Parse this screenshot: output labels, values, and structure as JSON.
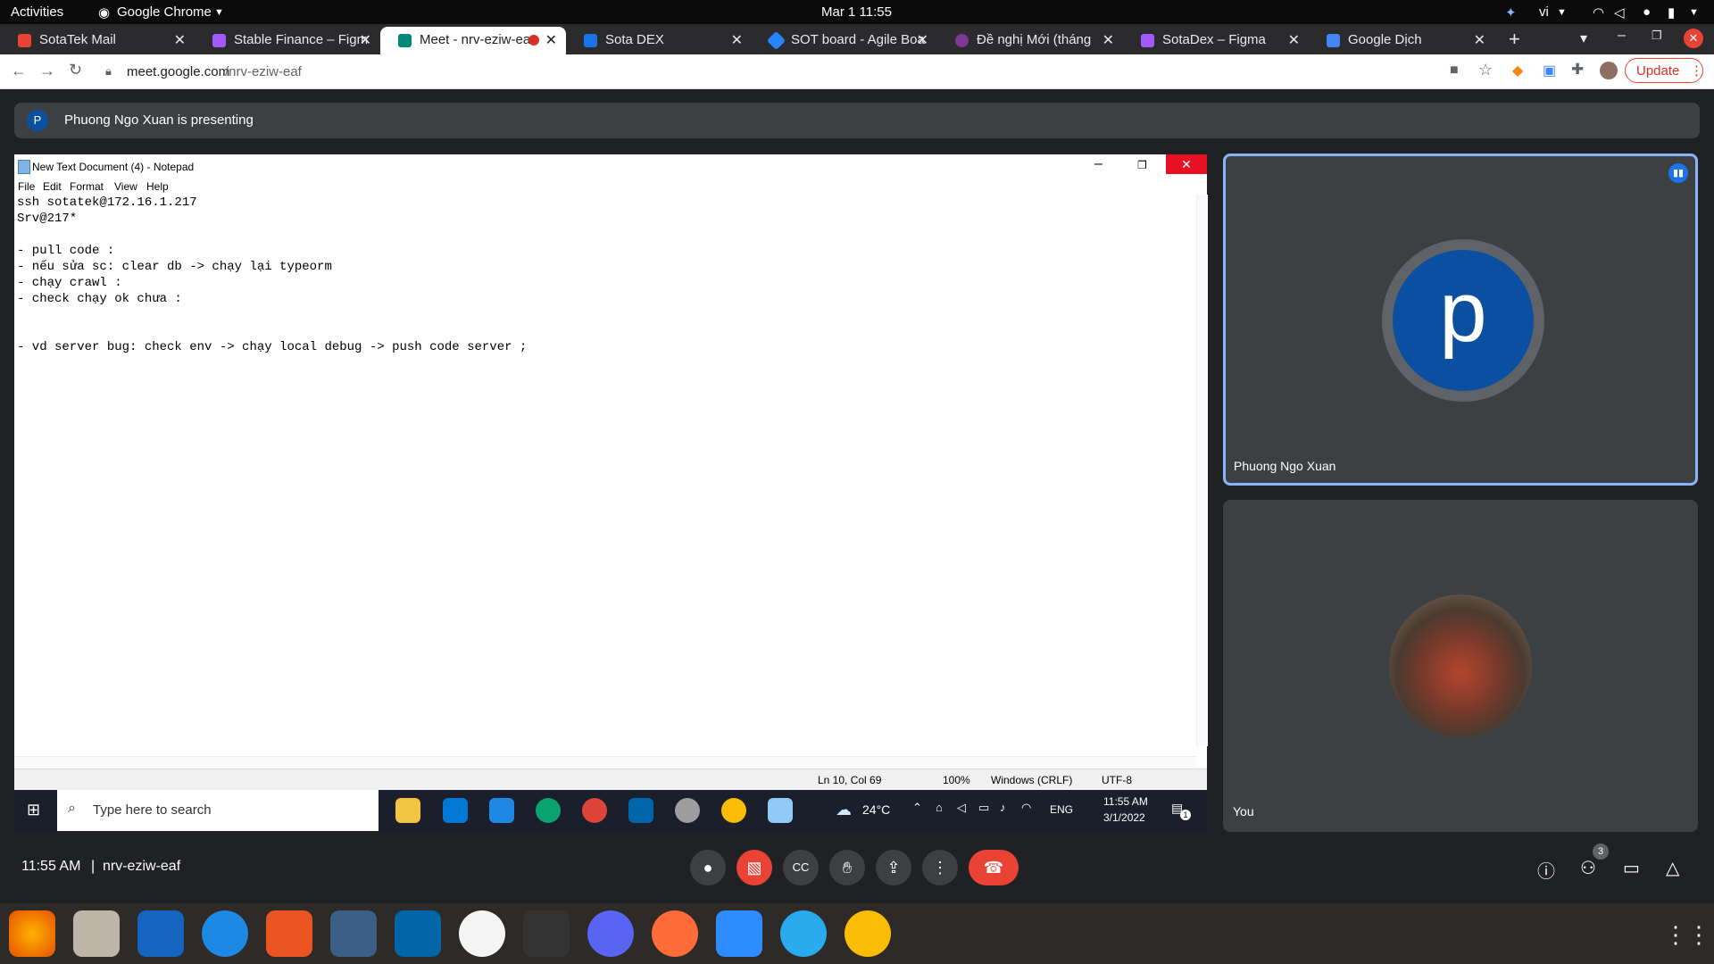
{
  "gnome": {
    "activities": "Activities",
    "app_name": "Google Chrome",
    "clock": "Mar 1  11:55",
    "lang": "vi"
  },
  "tabs": [
    {
      "label": "SotaTek Mail",
      "color": "#ea4335",
      "active": false
    },
    {
      "label": "Stable Finance – Figma",
      "color": "#a259ff",
      "active": false
    },
    {
      "label": "Meet - nrv-eziw-eaf",
      "color": "#00897b",
      "active": true
    },
    {
      "label": "Sota DEX",
      "color": "#1a73e8",
      "active": false
    },
    {
      "label": "SOT board - Agile Board",
      "color": "#2684ff",
      "active": false
    },
    {
      "label": "Đề nghị Mới (tháng",
      "color": "#7e3794",
      "active": false
    },
    {
      "label": "SotaDex – Figma",
      "color": "#a259ff",
      "active": false
    },
    {
      "label": "Google Dịch",
      "color": "#4285f4",
      "active": false
    }
  ],
  "toolbar": {
    "url_host": "meet.google.com",
    "url_path": "/nrv-eziw-eaf",
    "update_label": "Update"
  },
  "banner": {
    "avatar_letter": "P",
    "text": "Phuong Ngo Xuan is presenting"
  },
  "notepad": {
    "title": "New Text Document (4) - Notepad",
    "menu": [
      "File",
      "Edit",
      "Format",
      "View",
      "Help"
    ],
    "lines": [
      "ssh sotatek@172.16.1.217",
      "Srv@217*",
      "",
      "- pull code :",
      "- nếu sửa sc: clear db -> chạy lại typeorm",
      "- chạy crawl :",
      "- check chạy ok chưa :",
      "",
      "",
      "- vd server bug: check env -> chạy local debug -> push code server ;"
    ],
    "status": {
      "position": "Ln 10, Col 69",
      "zoom": "100%",
      "line_ending": "Windows (CRLF)",
      "encoding": "UTF-8"
    }
  },
  "win_taskbar": {
    "search_placeholder": "Type here to search",
    "weather": "24°C",
    "lang": "ENG",
    "time": "11:55 AM",
    "date": "3/1/2022",
    "notif_count": "1"
  },
  "tiles": {
    "presenter_name": "Phuong Ngo Xuan",
    "presenter_letter": "p",
    "self_name": "You"
  },
  "meet_bar": {
    "time": "11:55 AM",
    "separator": "|",
    "meeting_code": "nrv-eziw-eaf",
    "participants_count": "3"
  },
  "colors": {
    "accent_blue": "#8ab4f8",
    "avatar_blue": "#0b4fa0",
    "hangup_red": "#ea4335"
  }
}
